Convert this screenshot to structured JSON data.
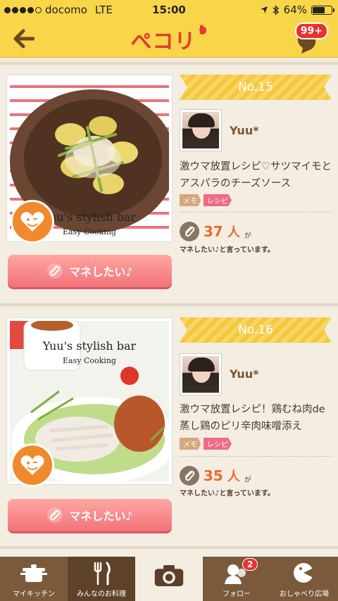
{
  "status_bar": {
    "carrier": "docomo",
    "network": "LTE",
    "time": "15:00",
    "battery": "64%",
    "battery_level": 0.64
  },
  "header": {
    "logo_text": "ぺコリ",
    "notification_count": "99+"
  },
  "posts": [
    {
      "rank": "No.15",
      "username": "Yuu*",
      "title": "激ウマ放置レシピ♡サツマイモとアスパラのチーズソース",
      "tags": [
        "メモ",
        "レシピ"
      ],
      "count": "37",
      "count_unit": "人",
      "count_suffix": "が",
      "caption": "マネしたい♪と言っています。",
      "button_label": "マネしたい♪",
      "photo_title": "Yuu's stylish bar",
      "photo_subtitle": "Easy Cooking"
    },
    {
      "rank": "No.16",
      "username": "Yuu*",
      "title": "激ウマ放置レシピ！鶏むね肉de 蒸し鶏のピリ辛肉味噌添え",
      "tags": [
        "メモ",
        "レシピ"
      ],
      "count": "35",
      "count_unit": "人",
      "count_suffix": "が",
      "caption": "マネしたい♪と言っています。",
      "button_label": "マネしたい♪",
      "photo_title": "Yuu's stylish bar",
      "photo_subtitle": "Easy Cooking"
    }
  ],
  "tabbar": {
    "tabs": [
      {
        "label": "マイキッチン",
        "icon": "pot-icon"
      },
      {
        "label": "みんなのお料理",
        "icon": "fork-knife-icon"
      },
      {
        "label": "",
        "icon": "camera-icon"
      },
      {
        "label": "フォロー",
        "icon": "follow-icon",
        "badge": "2"
      },
      {
        "label": "おしゃべり広場",
        "icon": "chat-face-icon"
      }
    ]
  },
  "colors": {
    "header_yellow": "#f9d54a",
    "brand_red": "#e23b2e",
    "count_orange": "#ee6a2b",
    "button_pink": "#f2737a",
    "tabbar_brown": "#7a5a3a"
  }
}
